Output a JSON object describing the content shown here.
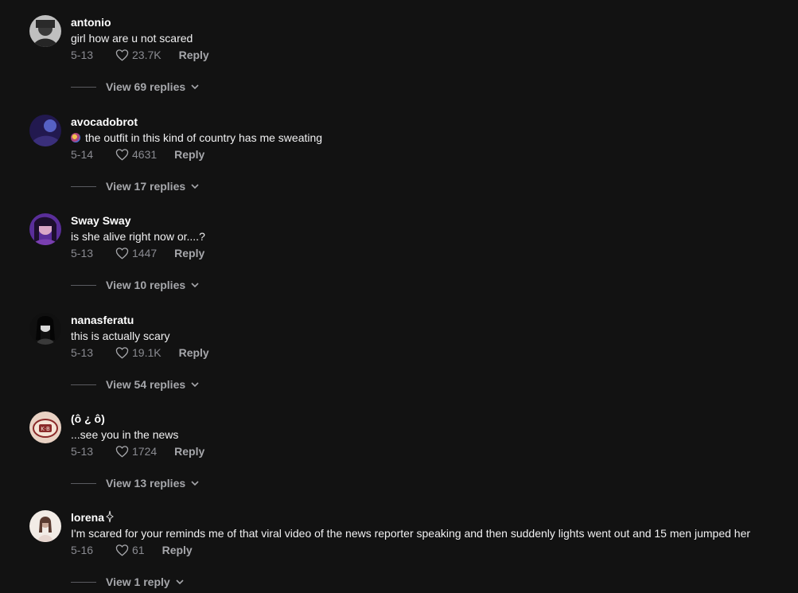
{
  "comments": [
    {
      "username": "antonio",
      "text": "girl how are u not scared",
      "date": "5-13",
      "likes": "23.7K",
      "reply_label": "Reply",
      "view_replies_label": "View 69 replies",
      "avatar_colors": [
        "#cfcfcf",
        "#3a3a3a"
      ]
    },
    {
      "username": "avocadobrot",
      "text": "the outfit in this kind of country has me sweating",
      "date": "5-14",
      "likes": "4631",
      "reply_label": "Reply",
      "view_replies_label": "View 17 replies",
      "avatar_colors": [
        "#3b3f8f",
        "#1a1440"
      ]
    },
    {
      "username": "Sway Sway",
      "text": "is she alive right now or....?",
      "date": "5-13",
      "likes": "1447",
      "reply_label": "Reply",
      "view_replies_label": "View 10 replies",
      "avatar_colors": [
        "#7a3fb0",
        "#2d1a55"
      ]
    },
    {
      "username": "nanasferatu",
      "text": "this is actually scary",
      "date": "5-13",
      "likes": "19.1K",
      "reply_label": "Reply",
      "view_replies_label": "View 54 replies",
      "avatar_colors": [
        "#202020",
        "#d8d8d8"
      ]
    },
    {
      "username": "(ô ¿ ô)",
      "text": "...see you in the news",
      "date": "5-13",
      "likes": "1724",
      "reply_label": "Reply",
      "view_replies_label": "View 13 replies",
      "avatar_colors": [
        "#e9d2c4",
        "#8a2a2a"
      ]
    },
    {
      "username": "lorena",
      "text": "I'm scared for your reminds me of that viral video of the news reporter speaking and then suddenly lights went out and 15 men jumped her",
      "date": "5-16",
      "likes": "61",
      "reply_label": "Reply",
      "view_replies_label": "View 1 reply",
      "avatar_colors": [
        "#f2ece6",
        "#c9a999"
      ]
    }
  ],
  "colors": {
    "background": "#121212",
    "username": "#ffffff",
    "body_text": "#f1f1f2",
    "meta_text": "#8a8b91",
    "action_text": "#a6a7ab"
  },
  "icons": {
    "like": "heart-outline-icon",
    "expand": "chevron-down-icon"
  }
}
